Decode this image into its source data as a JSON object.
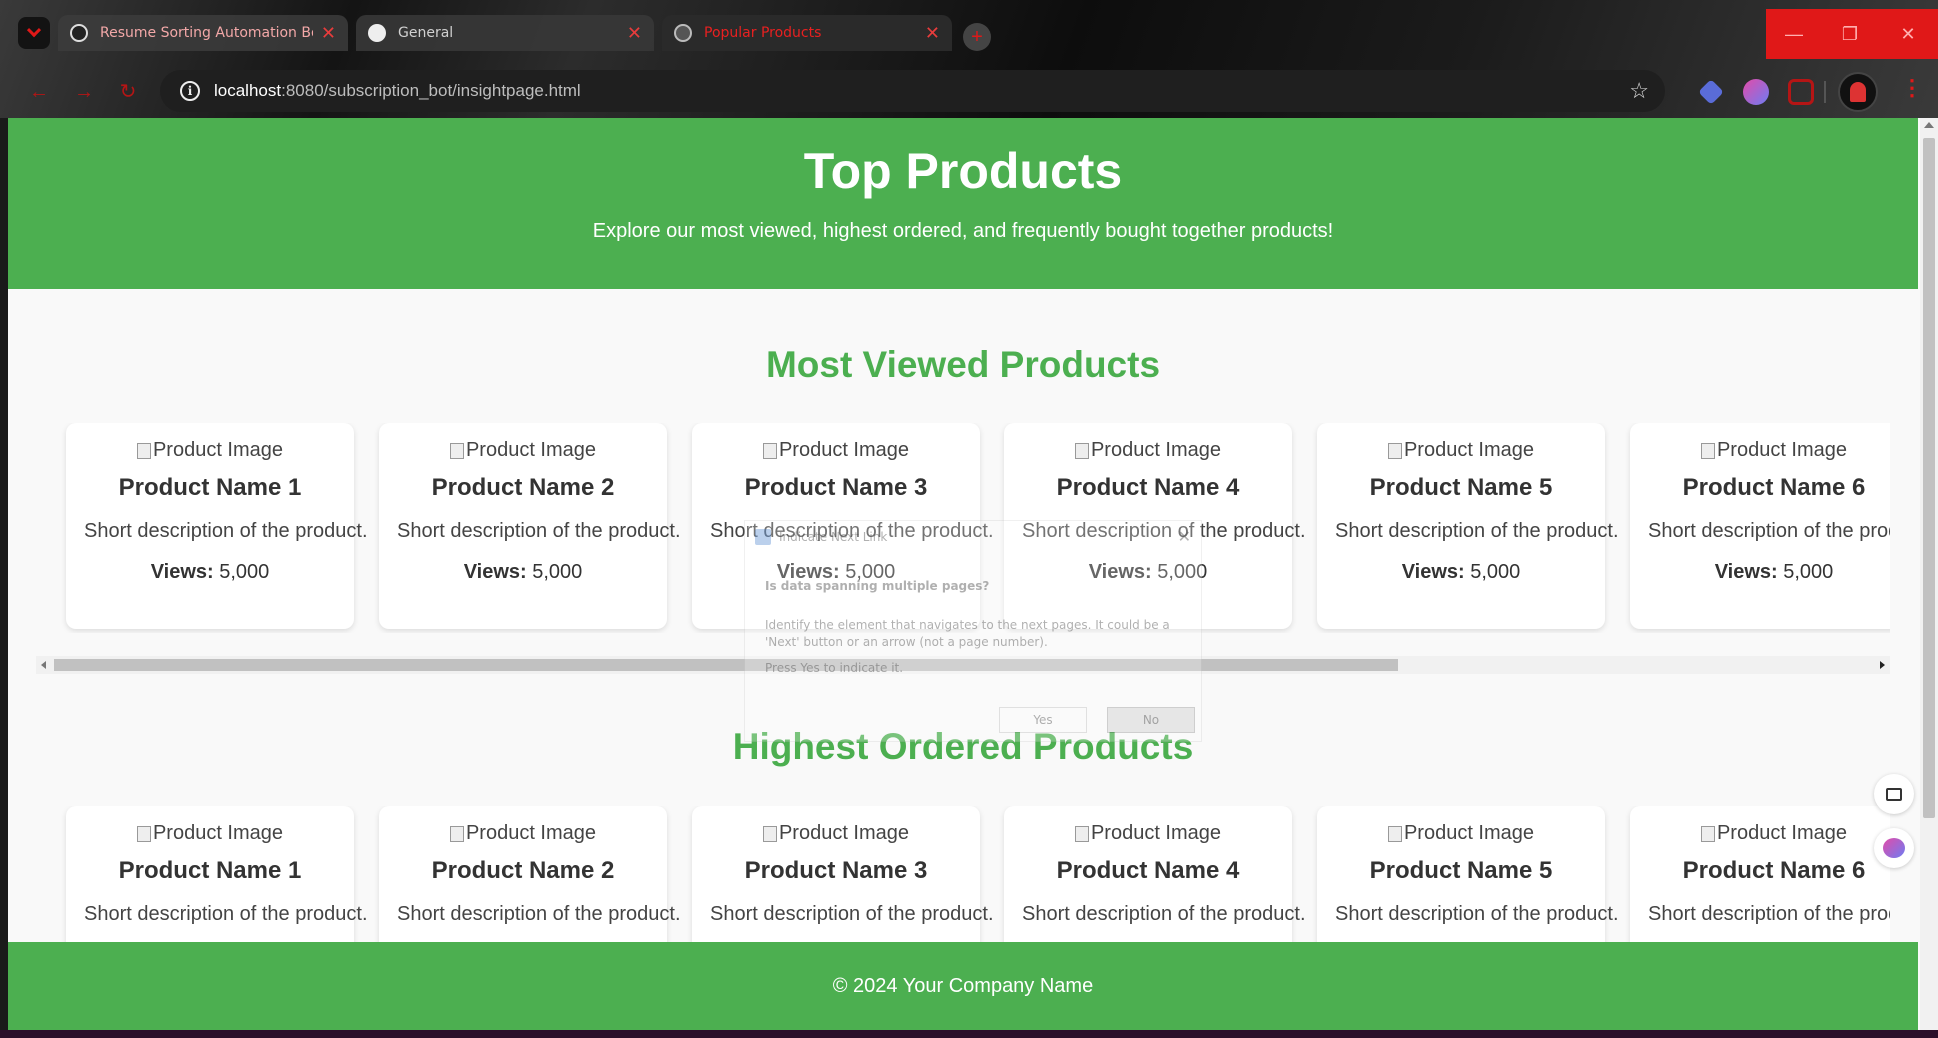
{
  "browser": {
    "tabs": [
      {
        "label": "Resume Sorting Automation Bo",
        "close": "✕"
      },
      {
        "label": "General",
        "close": "✕"
      },
      {
        "label": "Popular Products",
        "close": "✕"
      }
    ],
    "new_tab": "+",
    "window_controls": {
      "minimize": "—",
      "maximize": "❐",
      "close": "✕"
    },
    "nav": {
      "back": "←",
      "forward": "→",
      "reload": "↻"
    },
    "url_host": "localhost",
    "url_path": ":8080/subscription_bot/insightpage.html",
    "info_glyph": "i",
    "star_glyph": "☆",
    "menu_glyph": "⋮"
  },
  "header": {
    "title": "Top Products",
    "subtitle": "Explore our most viewed, highest ordered, and frequently bought together products!"
  },
  "sections": [
    {
      "title": "Most Viewed Products",
      "products": [
        {
          "image_alt": "Product Image",
          "name": "Product Name 1",
          "description": "Short description of the product.",
          "metric_label": "Views:",
          "metric_value": "5,000"
        },
        {
          "image_alt": "Product Image",
          "name": "Product Name 2",
          "description": "Short description of the product.",
          "metric_label": "Views:",
          "metric_value": "5,000"
        },
        {
          "image_alt": "Product Image",
          "name": "Product Name 3",
          "description": "Short description of the product.",
          "metric_label": "Views:",
          "metric_value": "5,000"
        },
        {
          "image_alt": "Product Image",
          "name": "Product Name 4",
          "description": "Short description of the product.",
          "metric_label": "Views:",
          "metric_value": "5,000"
        },
        {
          "image_alt": "Product Image",
          "name": "Product Name 5",
          "description": "Short description of the product.",
          "metric_label": "Views:",
          "metric_value": "5,000"
        },
        {
          "image_alt": "Product Image",
          "name": "Product Name 6",
          "description": "Short description of the product.",
          "metric_label": "Views:",
          "metric_value": "5,000"
        }
      ]
    },
    {
      "title": "Highest Ordered Products",
      "products": [
        {
          "image_alt": "Product Image",
          "name": "Product Name 1",
          "description": "Short description of the product."
        },
        {
          "image_alt": "Product Image",
          "name": "Product Name 2",
          "description": "Short description of the product."
        },
        {
          "image_alt": "Product Image",
          "name": "Product Name 3",
          "description": "Short description of the product."
        },
        {
          "image_alt": "Product Image",
          "name": "Product Name 4",
          "description": "Short description of the product."
        },
        {
          "image_alt": "Product Image",
          "name": "Product Name 5",
          "description": "Short description of the product."
        },
        {
          "image_alt": "Product Image",
          "name": "Product Name 6",
          "description": "Short description of the product."
        }
      ]
    }
  ],
  "footer": {
    "text": "© 2024 Your Company Name"
  },
  "dialog": {
    "title": "Indicate Next Link",
    "close": "✕",
    "question": "Is data spanning multiple pages?",
    "body": "Identify the element that navigates to the next pages. It could be a 'Next' button or an arrow (not a page number).",
    "hint": "Press Yes to indicate it.",
    "yes": "Yes",
    "no": "No"
  },
  "colors": {
    "brand_green": "#4caf50",
    "browser_accent": "#e01818"
  },
  "icons": [
    "chevron-down-icon",
    "openai-icon",
    "github-icon",
    "globe-icon",
    "info-icon",
    "star-icon",
    "extension-icon",
    "brain-icon",
    "puzzle-icon",
    "profile-avatar",
    "more-vert-icon",
    "book-icon"
  ]
}
